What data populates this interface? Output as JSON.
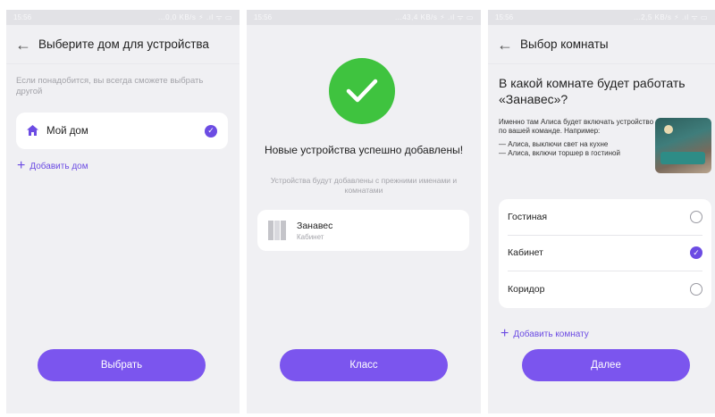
{
  "screen1": {
    "status": {
      "time": "15:56",
      "indicators": "...0,0 KB/s ⚡ .ıl ᯤ ▭"
    },
    "title": "Выберите дом для устройства",
    "hint": "Если понадобится, вы всегда сможете выбрать другой",
    "home_name": "Мой дом",
    "add_home": "Добавить дом",
    "button": "Выбрать"
  },
  "screen2": {
    "status": {
      "time": "15:56",
      "indicators": "...43,4 KB/s ⚡ .ıl ᯤ ▭"
    },
    "heading": "Новые устройства успешно добавлены!",
    "subtitle": "Устройства будут добавлены с прежними именами и комнатами",
    "device_name": "Занавес",
    "device_room": "Кабинет",
    "button": "Класс"
  },
  "screen3": {
    "status": {
      "time": "15:56",
      "indicators": "...2,5 KB/s ⚡ .ıl ᯤ ▭"
    },
    "title": "Выбор комнаты",
    "question": "В какой комнате будет работать «Занавес»?",
    "explain": "Именно там Алиса будет включать устройство по вашей команде. Например:",
    "example1": "— Алиса, выключи свет на кухне",
    "example2": "— Алиса, включи торшер в гостиной",
    "rooms": [
      {
        "label": "Гостиная",
        "selected": false
      },
      {
        "label": "Кабинет",
        "selected": true
      },
      {
        "label": "Коридор",
        "selected": false
      }
    ],
    "add_room": "Добавить комнату",
    "button": "Далее"
  },
  "colors": {
    "accent": "#7b55ee",
    "success": "#3fc33f",
    "background": "#f0f0f3"
  }
}
